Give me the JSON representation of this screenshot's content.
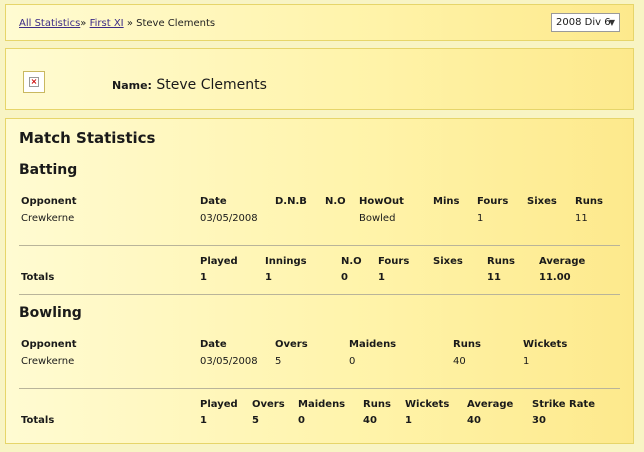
{
  "breadcrumb": {
    "items": [
      "All Statistics",
      "First XI"
    ],
    "separator": "»",
    "current": "Steve Clements"
  },
  "season_select": {
    "value": "2008 Div 6"
  },
  "player": {
    "name_label": "Name:",
    "name": "Steve Clements"
  },
  "match_title": "Match Statistics",
  "batting": {
    "title": "Batting",
    "headers": [
      "Opponent",
      "Date",
      "D.N.B",
      "N.O",
      "HowOut",
      "Mins",
      "Fours",
      "Sixes",
      "Runs"
    ],
    "rows": [
      [
        "Crewkerne",
        "03/05/2008",
        "",
        "",
        "Bowled",
        "",
        "1",
        "",
        "11"
      ]
    ],
    "totals_label": "Totals",
    "totals_headers": [
      "Played",
      "Innings",
      "N.O",
      "Fours",
      "Sixes",
      "Runs",
      "Average"
    ],
    "totals_values": [
      "1",
      "1",
      "0",
      "1",
      "",
      "11",
      "11.00"
    ]
  },
  "bowling": {
    "title": "Bowling",
    "headers": [
      "Opponent",
      "Date",
      "Overs",
      "Maidens",
      "Runs",
      "Wickets"
    ],
    "rows": [
      [
        "Crewkerne",
        "03/05/2008",
        "5",
        "0",
        "40",
        "1"
      ]
    ],
    "totals_label": "Totals",
    "totals_headers": [
      "Played",
      "Overs",
      "Maidens",
      "Runs",
      "Wickets",
      "Average",
      "Strike Rate"
    ],
    "totals_values": [
      "1",
      "5",
      "0",
      "40",
      "1",
      "40",
      "30"
    ]
  }
}
